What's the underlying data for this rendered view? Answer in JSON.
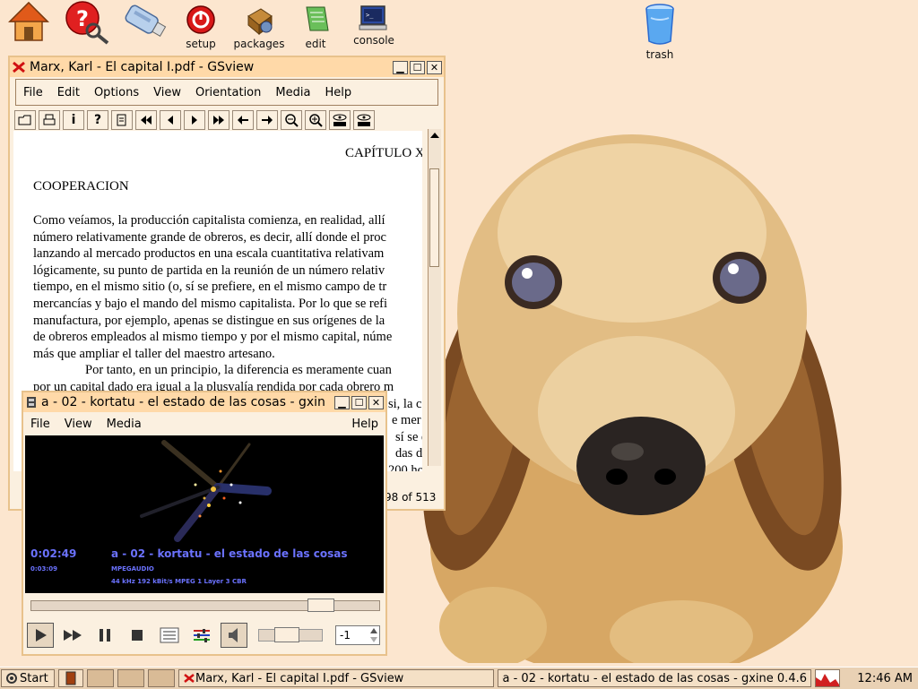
{
  "desktop": {
    "icons": [
      {
        "name": "home-icon",
        "label": ""
      },
      {
        "name": "help-icon",
        "label": ""
      },
      {
        "name": "usb-drive-icon",
        "label": ""
      },
      {
        "name": "setup-icon",
        "label": "setup"
      },
      {
        "name": "packages-icon",
        "label": "packages"
      },
      {
        "name": "edit-icon",
        "label": "edit"
      },
      {
        "name": "console-icon",
        "label": "console"
      },
      {
        "name": "trash-icon",
        "label": "trash"
      }
    ]
  },
  "gsview": {
    "title": "Marx, Karl - El capital I.pdf - GSview",
    "menu": [
      "File",
      "Edit",
      "Options",
      "View",
      "Orientation",
      "Media",
      "Help"
    ],
    "toolbar": [
      "open-icon",
      "print-icon",
      "info-icon",
      "help-icon",
      "page-select-icon",
      "first-page-icon",
      "prev-page-icon",
      "next-page-icon",
      "last-page-icon",
      "back-icon",
      "forward-icon",
      "zoom-out-icon",
      "zoom-in-icon",
      "text-search-icon",
      "text-find-next-icon"
    ],
    "doc": {
      "chapter": "CAPÍTULO X",
      "heading": "COOPERACION",
      "lines": [
        "Como veíamos, la producción capitalista comienza, en realidad, allí",
        "número relativamente grande de obreros, es decir, allí donde el proc",
        "lanzando al mercado productos en una escala cuantitativa relativam",
        "lógicamente, su punto de partida en la reunión de un número relativ",
        "tiempo, en el mismo sitio (o, sí se prefiere, en el mismo campo de tr",
        "mercancías y bajo el mando del mismo capitalista. Por lo que se refi",
        "manufactura, por ejemplo, apenas se distingue en sus orígenes de la",
        "de obreros empleados al mismo tiempo y por el mismo capital, núme",
        "más que ampliar el taller del maestro artesano.",
        "Por tanto, en un principio, la diferencia es meramente cuan",
        "por un capital dado era igual a la plusvalía rendida por cada obrero m",
        "si, la c",
        "e mer",
        "sí se d",
        "das de",
        "200 ho"
      ]
    },
    "page_status": "98 of 513"
  },
  "gxine": {
    "title": "a - 02 - kortatu - el estado de las cosas - gxin",
    "menu": [
      "File",
      "View",
      "Media"
    ],
    "help": "Help",
    "time_elapsed": "0:02:49",
    "time_total": "0:03:09",
    "track": "a - 02 - kortatu - el estado de las cosas",
    "codec": "MPEGAUDIO",
    "stream_info": "44 kHz 192 kBit/s MPEG 1 Layer 3 CBR",
    "seek_fraction": 0.86,
    "volume_fraction": 0.4,
    "spin_value": "-1",
    "colors": {
      "video_text": "#6b72ff"
    }
  },
  "taskbar": {
    "start": "Start",
    "tasks": [
      "Marx, Karl - El capital I.pdf - GSview",
      "a - 02 - kortatu - el estado de las cosas - gxine 0.4.6"
    ],
    "clock": "12:46 AM"
  }
}
